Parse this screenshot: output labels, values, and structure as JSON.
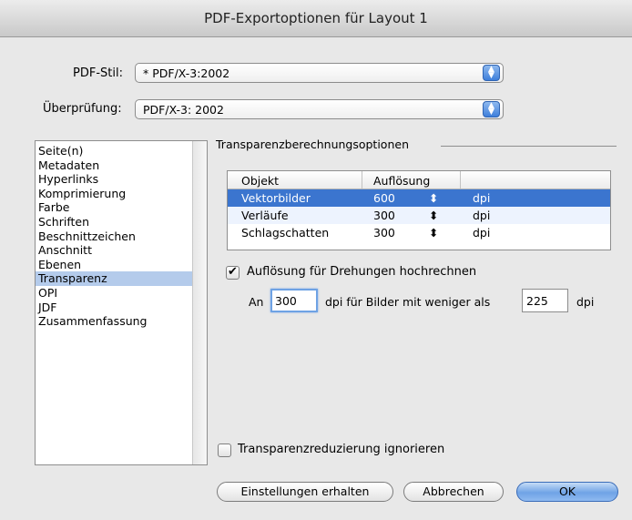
{
  "window": {
    "title": "PDF-Exportoptionen für Layout 1"
  },
  "pdf_style": {
    "label": "PDF-Stil:",
    "value": "* PDF/X-3:2002"
  },
  "verification": {
    "label": "Überprüfung:",
    "value": "PDF/X-3: 2002"
  },
  "sidebar": {
    "items": [
      {
        "label": "Seite(n)"
      },
      {
        "label": "Metadaten"
      },
      {
        "label": "Hyperlinks"
      },
      {
        "label": "Komprimierung"
      },
      {
        "label": "Farbe"
      },
      {
        "label": "Schriften"
      },
      {
        "label": "Beschnittzeichen"
      },
      {
        "label": "Anschnitt"
      },
      {
        "label": "Ebenen"
      },
      {
        "label": "Transparenz",
        "selected": true
      },
      {
        "label": "OPI"
      },
      {
        "label": "JDF"
      },
      {
        "label": "Zusammenfassung"
      }
    ]
  },
  "transparency": {
    "section_title": "Transparenzberechnungsoptionen",
    "table": {
      "headers": {
        "object": "Objekt",
        "resolution": "Auflösung"
      },
      "rows": [
        {
          "object": "Vektorbilder",
          "resolution": "600",
          "stepper": "⬍",
          "unit": "dpi",
          "selected": true
        },
        {
          "object": "Verläufe",
          "resolution": "300",
          "stepper": "⬍",
          "unit": "dpi"
        },
        {
          "object": "Schlagschatten",
          "resolution": "300",
          "stepper": "⬍",
          "unit": "dpi"
        }
      ]
    },
    "upsample": {
      "checked": true,
      "label": "Auflösung für Drehungen hochrechnen",
      "prefix": "An",
      "dpi_value": "300",
      "middle_text": "dpi für Bilder mit weniger als",
      "threshold_value": "225",
      "suffix": "dpi"
    },
    "ignore_flattener": {
      "checked": false,
      "label": "Transparenzreduzierung ignorieren"
    }
  },
  "buttons": {
    "keep_settings": "Einstellungen erhalten",
    "cancel": "Abbrechen",
    "ok": "OK"
  }
}
